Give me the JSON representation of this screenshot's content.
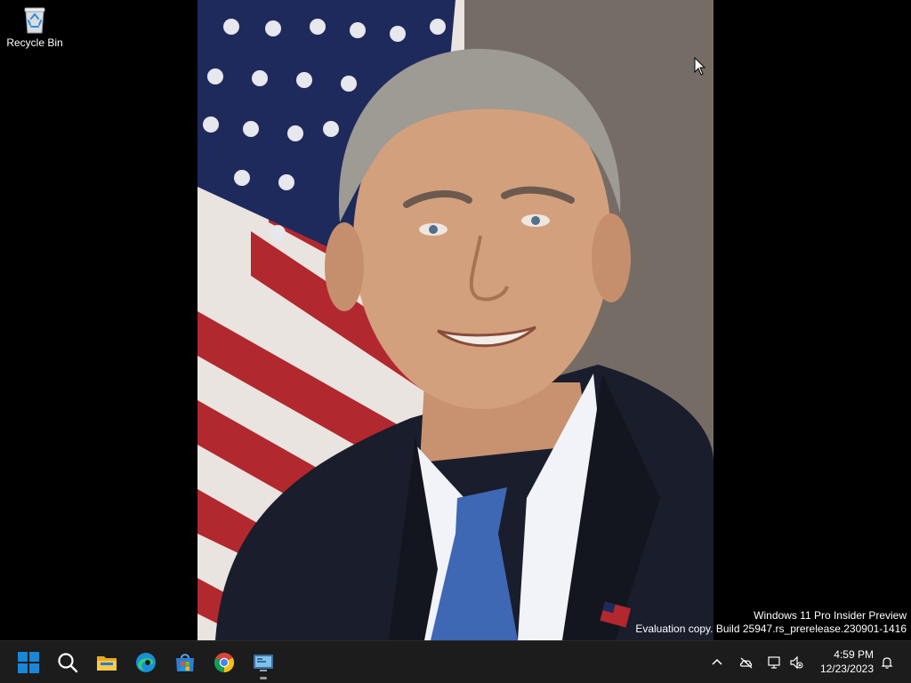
{
  "desktop": {
    "icons": [
      {
        "label": "Recycle Bin",
        "icon": "recycle-bin-icon"
      }
    ],
    "wallpaper": {
      "subject": "portrait-photo"
    }
  },
  "watermark": {
    "line1": "Windows 11 Pro Insider Preview",
    "line2": "Evaluation copy. Build 25947.rs_prerelease.230901-1416"
  },
  "taskbar": {
    "apps": [
      {
        "icon": "windows-start-icon"
      },
      {
        "icon": "search-icon"
      },
      {
        "icon": "file-explorer-icon"
      },
      {
        "icon": "edge-icon"
      },
      {
        "icon": "microsoft-store-icon"
      },
      {
        "icon": "chrome-icon"
      },
      {
        "icon": "remote-desktop-icon",
        "running": true
      }
    ],
    "tray": {
      "icons": [
        "chevron-up-icon",
        "onedrive-icon",
        "network-icon",
        "volume-muted-icon",
        "notification-bell-icon"
      ],
      "time": "4:59 PM",
      "date": "12/23/2023"
    }
  },
  "colors": {
    "taskbar_bg": "#1c1c1c",
    "desktop_bg": "#000000",
    "start_blue": "#1a86d6"
  }
}
